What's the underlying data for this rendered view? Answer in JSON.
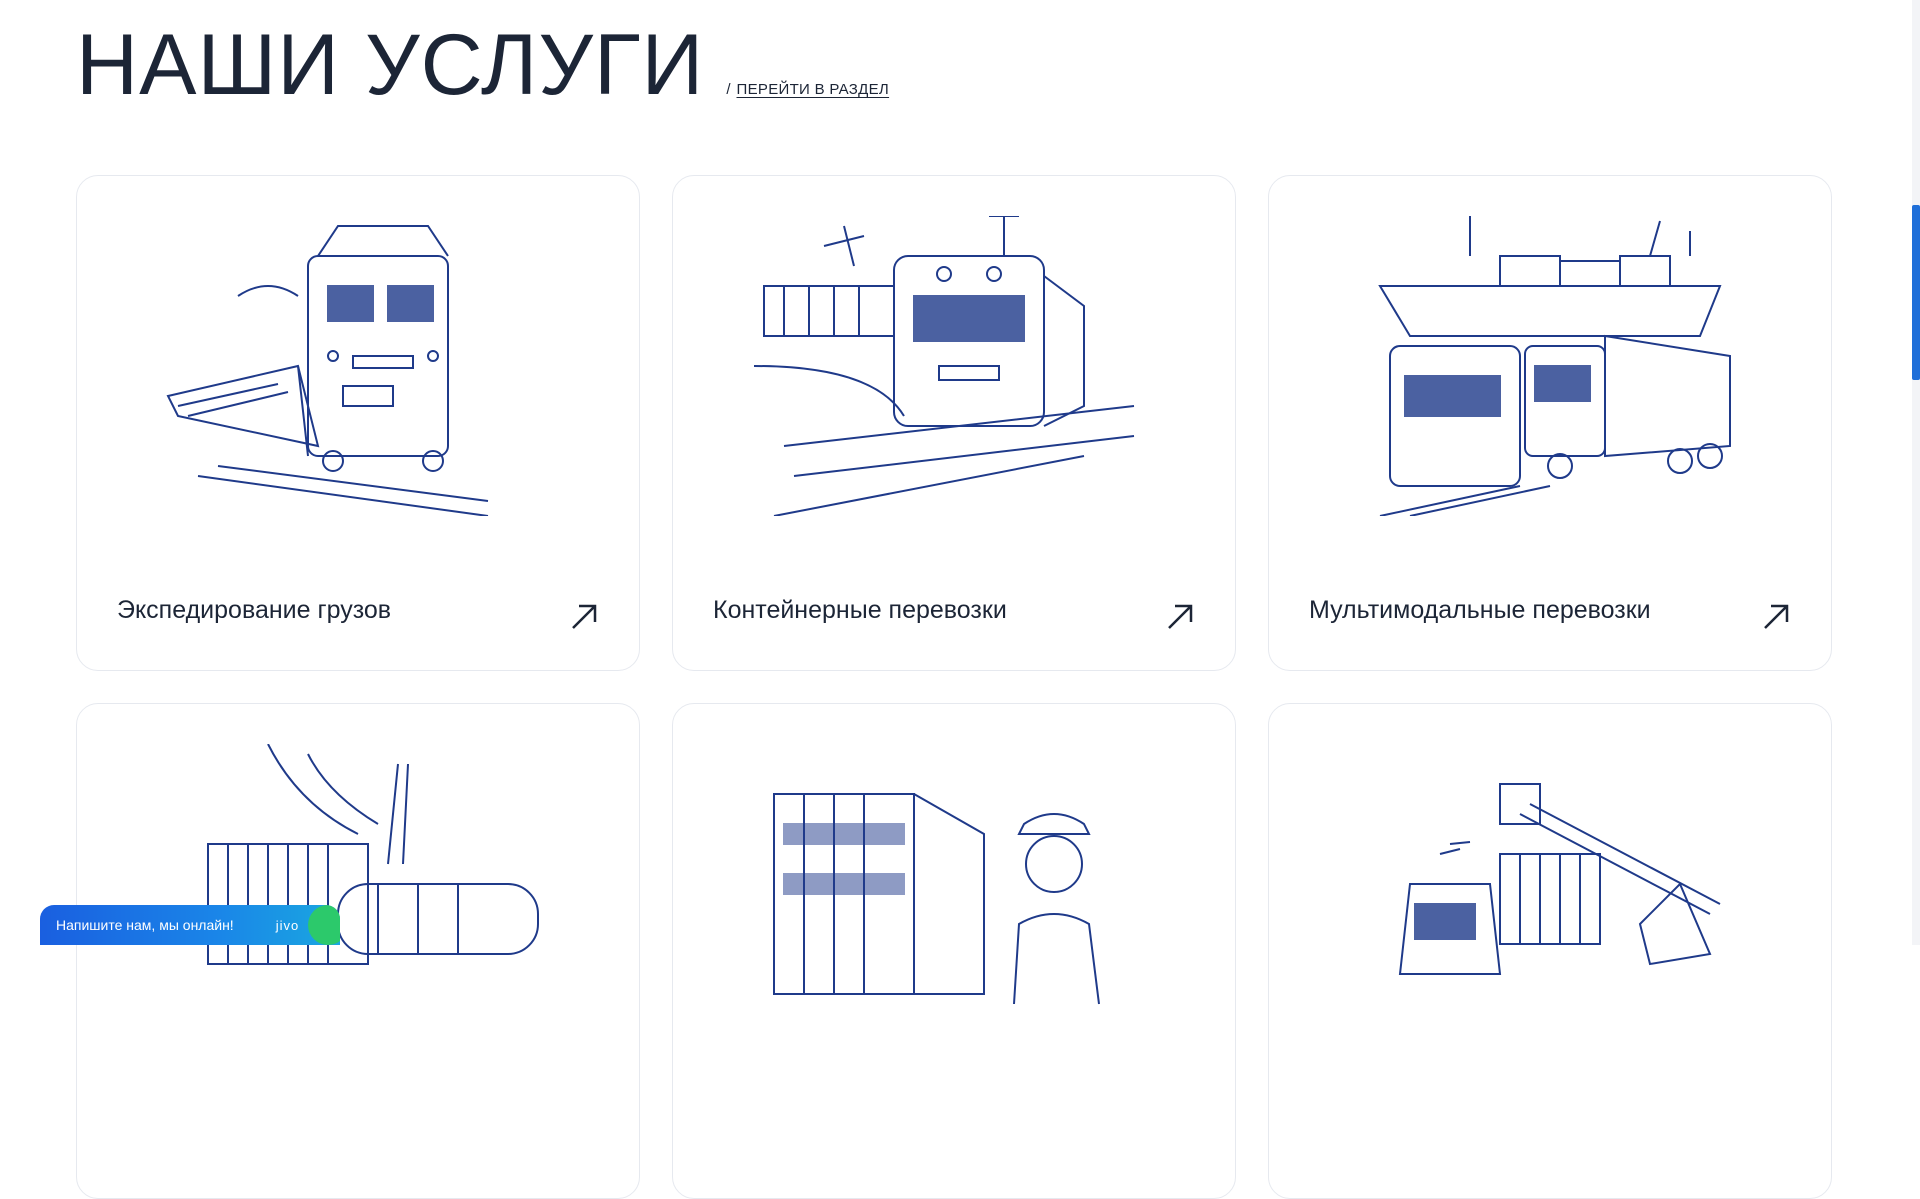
{
  "header": {
    "title": "НАШИ УСЛУГИ",
    "separator": "/",
    "link_label": "ПЕРЕЙТИ В РАЗДЕЛ"
  },
  "services": [
    {
      "title": "Экспедирование грузов",
      "illustration": "locomotive-train-illustration"
    },
    {
      "title": "Контейнерные перевозки",
      "illustration": "container-train-illustration"
    },
    {
      "title": "Мультимодальные перевозки",
      "illustration": "ship-train-truck-illustration"
    },
    {
      "title": "",
      "illustration": "tank-train-illustration"
    },
    {
      "title": "",
      "illustration": "container-truck-stewardess-illustration"
    },
    {
      "title": "",
      "illustration": "crane-truck-illustration"
    }
  ],
  "chat_widget": {
    "text": "Напишите нам, мы онлайн!",
    "logo": "jivo"
  },
  "colors": {
    "text": "#1c2536",
    "illustration": "#1f3a8a",
    "accent": "#1f6fd9",
    "chat_green": "#2cc96b"
  }
}
